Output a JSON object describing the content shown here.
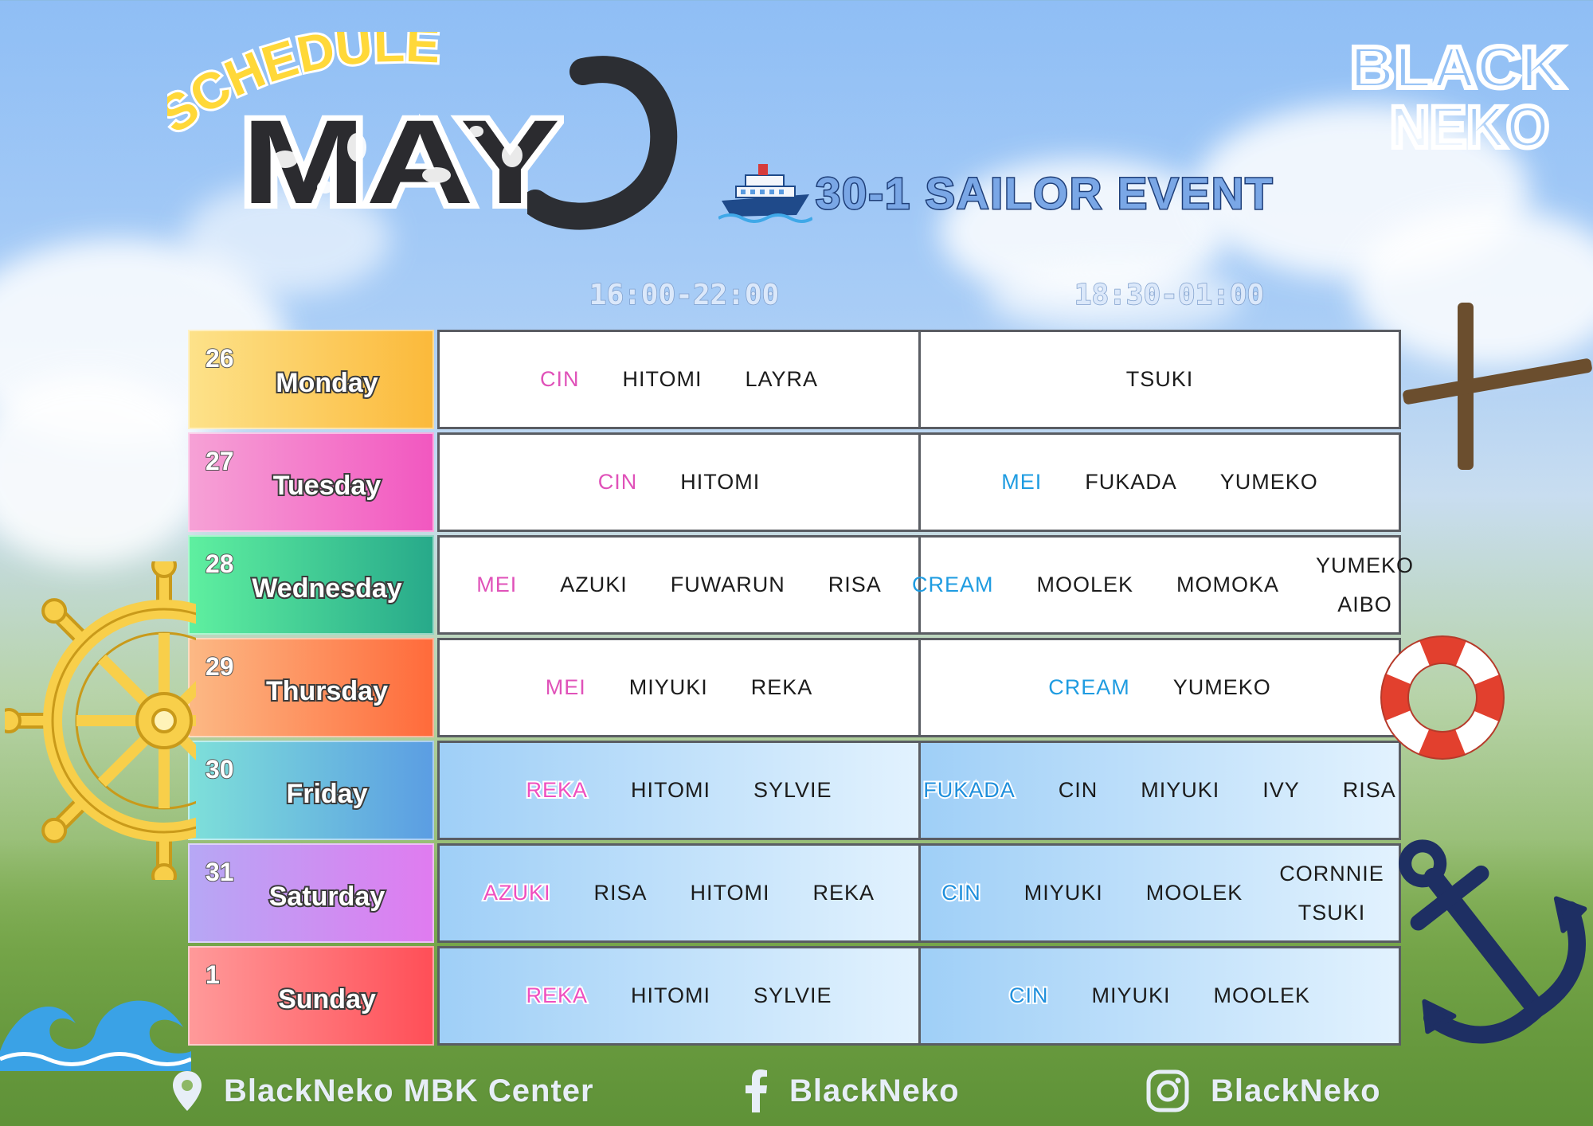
{
  "header": {
    "schedule_label": "SCHEDULE",
    "month": "MAY",
    "event_title": "30-1 SAILOR EVENT",
    "logo_line1": "BLACK",
    "logo_line2": "NEKO"
  },
  "shifts": [
    "16:00-22:00",
    "18:30-01:00"
  ],
  "colors": {
    "monday": [
      "#fde28a",
      "#fbb93a"
    ],
    "tuesday": [
      "#f6a2d6",
      "#f257c0"
    ],
    "wednesday": [
      "#5ff0a0",
      "#27a98a"
    ],
    "thursday": [
      "#fcb985",
      "#ff6a3a"
    ],
    "friday": [
      "#7ee0d9",
      "#5b9de3"
    ],
    "saturday": [
      "#b6a8f5",
      "#e07bf0"
    ],
    "sunday": [
      "#ff9a9a",
      "#ff4e57"
    ],
    "grid_border": "#5a5d63",
    "highlight_pink": "#e052b9",
    "highlight_cyan": "#1f9ce1"
  },
  "days": [
    {
      "num": "26",
      "name": "Monday",
      "shift1": [
        {
          "n": "CIN",
          "c": "pink"
        },
        {
          "n": "HITOMI"
        },
        {
          "n": "LAYRA"
        }
      ],
      "shift2": [
        {
          "n": "TSUKI"
        }
      ]
    },
    {
      "num": "27",
      "name": "Tuesday",
      "shift1": [
        {
          "n": "CIN",
          "c": "pink"
        },
        {
          "n": "HITOMI"
        }
      ],
      "shift2": [
        {
          "n": "MEI",
          "c": "cyan"
        },
        {
          "n": "FUKADA"
        },
        {
          "n": "YUMEKO"
        }
      ]
    },
    {
      "num": "28",
      "name": "Wednesday",
      "shift1": [
        {
          "n": "MEI",
          "c": "pink"
        },
        {
          "n": "AZUKI"
        },
        {
          "n": "FUWARUN"
        },
        {
          "n": "RISA"
        }
      ],
      "shift2": [
        {
          "n": "CREAM",
          "c": "cyan"
        },
        {
          "n": "MOOLEK"
        },
        {
          "n": "MOMOKA"
        },
        {
          "stack": [
            "YUMEKO",
            "AIBO"
          ]
        }
      ]
    },
    {
      "num": "29",
      "name": "Thursday",
      "shift1": [
        {
          "n": "MEI",
          "c": "pink"
        },
        {
          "n": "MIYUKI"
        },
        {
          "n": "REKA"
        }
      ],
      "shift2": [
        {
          "n": "CREAM",
          "c": "cyan"
        },
        {
          "n": "YUMEKO"
        }
      ]
    },
    {
      "num": "30",
      "name": "Friday",
      "blue": true,
      "shift1": [
        {
          "n": "REKA",
          "c": "pink"
        },
        {
          "n": "HITOMI"
        },
        {
          "n": "SYLVIE"
        }
      ],
      "shift2": [
        {
          "n": "FUKADA",
          "c": "cyan"
        },
        {
          "n": "CIN"
        },
        {
          "n": "MIYUKI"
        },
        {
          "n": "IVY"
        },
        {
          "n": "RISA"
        }
      ]
    },
    {
      "num": "31",
      "name": "Saturday",
      "blue": true,
      "shift1": [
        {
          "n": "AZUKI",
          "c": "pink"
        },
        {
          "n": "RISA"
        },
        {
          "n": "HITOMI"
        },
        {
          "n": "REKA"
        }
      ],
      "shift2": [
        {
          "n": "CIN",
          "c": "cyan"
        },
        {
          "n": "MIYUKI"
        },
        {
          "n": "MOOLEK"
        },
        {
          "stack": [
            "CORNNIE",
            "TSUKI"
          ]
        }
      ]
    },
    {
      "num": "1",
      "name": "Sunday",
      "blue": true,
      "shift1": [
        {
          "n": "REKA",
          "c": "pink"
        },
        {
          "n": "HITOMI"
        },
        {
          "n": "SYLVIE"
        }
      ],
      "shift2": [
        {
          "n": "CIN",
          "c": "cyan"
        },
        {
          "n": "MIYUKI"
        },
        {
          "n": "MOOLEK"
        }
      ]
    }
  ],
  "footer": {
    "location": "BlackNeko MBK Center",
    "facebook": "BlackNeko",
    "instagram": "BlackNeko",
    "icons": [
      "location-pin-icon",
      "facebook-icon",
      "instagram-icon"
    ]
  }
}
